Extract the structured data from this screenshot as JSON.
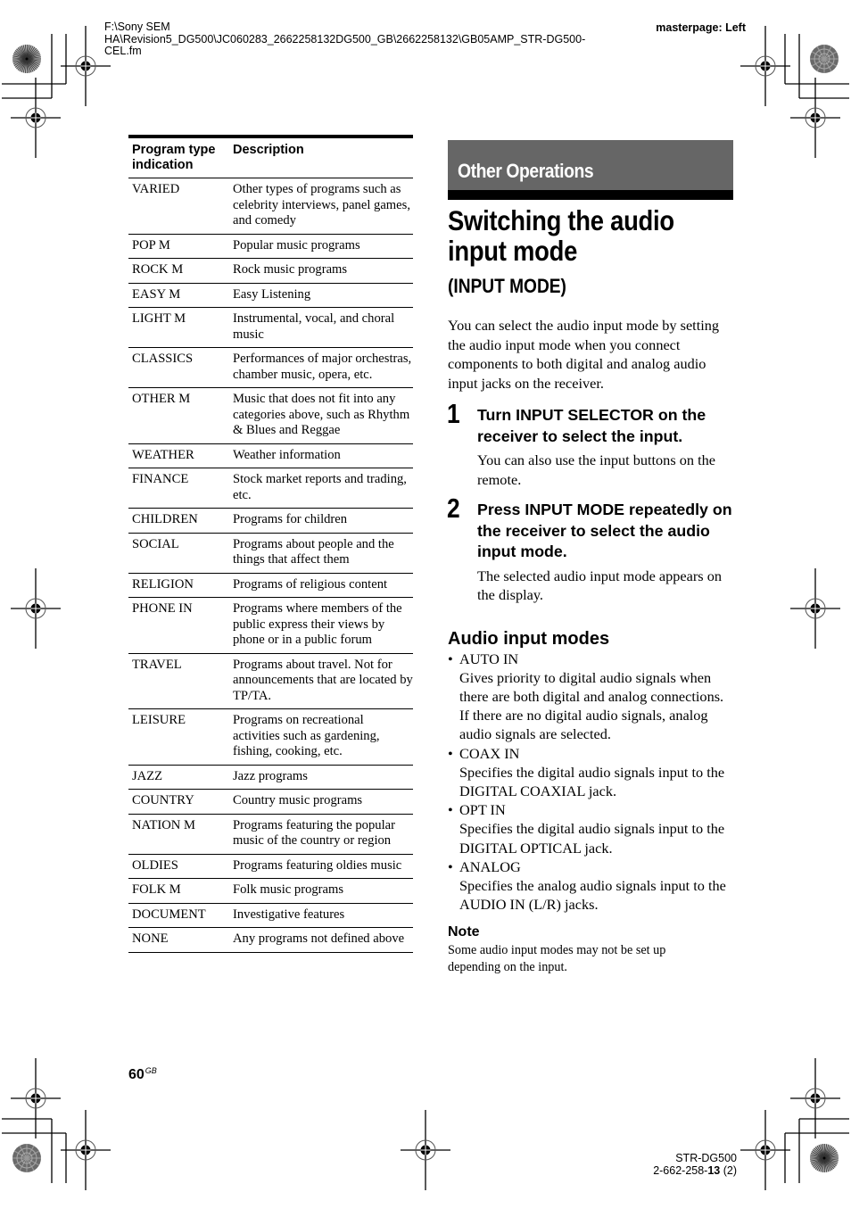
{
  "header": {
    "file_path_lines": [
      "F:\\Sony SEM",
      "HA\\Revision5_DG500\\JC060283_2662258132DG500_GB\\2662258132\\GB05AMP_STR-DG500-",
      "CEL.fm"
    ],
    "masterpage": "masterpage: Left"
  },
  "program_table": {
    "headers": [
      "Program type indication",
      "Description"
    ],
    "rows": [
      {
        "type": "VARIED",
        "description": "Other types of programs such as celebrity interviews, panel games, and comedy"
      },
      {
        "type": "POP M",
        "description": "Popular music programs"
      },
      {
        "type": "ROCK M",
        "description": "Rock music programs"
      },
      {
        "type": "EASY M",
        "description": "Easy Listening"
      },
      {
        "type": "LIGHT M",
        "description": "Instrumental, vocal, and choral music"
      },
      {
        "type": "CLASSICS",
        "description": "Performances of major orchestras, chamber music, opera, etc."
      },
      {
        "type": "OTHER M",
        "description": "Music that does not fit into any categories above, such as Rhythm & Blues and Reggae"
      },
      {
        "type": "WEATHER",
        "description": "Weather information"
      },
      {
        "type": "FINANCE",
        "description": "Stock market reports and trading, etc."
      },
      {
        "type": "CHILDREN",
        "description": "Programs for children"
      },
      {
        "type": "SOCIAL",
        "description": "Programs about people and the things that affect them"
      },
      {
        "type": "RELIGION",
        "description": "Programs of religious content"
      },
      {
        "type": "PHONE IN",
        "description": "Programs where members of the public express their views by phone or in a public forum"
      },
      {
        "type": "TRAVEL",
        "description": "Programs about travel. Not for announcements that are located by TP/TA."
      },
      {
        "type": "LEISURE",
        "description": "Programs on recreational activities such as gardening, fishing, cooking, etc."
      },
      {
        "type": "JAZZ",
        "description": "Jazz programs"
      },
      {
        "type": "COUNTRY",
        "description": "Country music programs"
      },
      {
        "type": "NATION M",
        "description": "Programs featuring the popular music of the country or region"
      },
      {
        "type": "OLDIES",
        "description": "Programs featuring oldies music"
      },
      {
        "type": "FOLK M",
        "description": "Folk music programs"
      },
      {
        "type": "DOCUMENT",
        "description": "Investigative features"
      },
      {
        "type": "NONE",
        "description": "Any programs not defined above"
      }
    ]
  },
  "section": {
    "chapter": "Other Operations",
    "title": "Switching the audio input mode",
    "subtitle": "(INPUT MODE)",
    "intro": "You can select the audio input mode by setting the audio input mode when you connect components to both digital and analog audio input jacks on the receiver.",
    "steps": [
      {
        "number": "1",
        "heading": "Turn INPUT SELECTOR on the receiver to select the input.",
        "body": "You can also use the input buttons on the remote."
      },
      {
        "number": "2",
        "heading": "Press INPUT MODE repeatedly on the receiver to select the audio input mode.",
        "body": "The selected audio input mode appears on the display."
      }
    ],
    "modes_heading": "Audio input modes",
    "bullet": "•",
    "modes": [
      {
        "name": "AUTO IN",
        "description": "Gives priority to digital audio signals when there are both digital and analog connections. If there are no digital audio signals, analog audio signals are selected."
      },
      {
        "name": "COAX IN",
        "description": "Specifies the digital audio signals input to the DIGITAL COAXIAL jack."
      },
      {
        "name": "OPT IN",
        "description": "Specifies the digital audio signals input to the DIGITAL OPTICAL jack."
      },
      {
        "name": "ANALOG",
        "description": "Specifies the analog audio signals input to the AUDIO IN (L/R) jacks."
      }
    ],
    "note_heading": "Note",
    "note_body": "Some audio input modes may not be set up depending on the input."
  },
  "footer": {
    "page_number": "60",
    "page_suffix": "GB",
    "model": "STR-DG500",
    "code_prefix": "2-662-258-",
    "code_bold": "13",
    "code_suffix": " (2)"
  },
  "colors": {
    "chapter_band": "#666666",
    "text": "#000000"
  }
}
